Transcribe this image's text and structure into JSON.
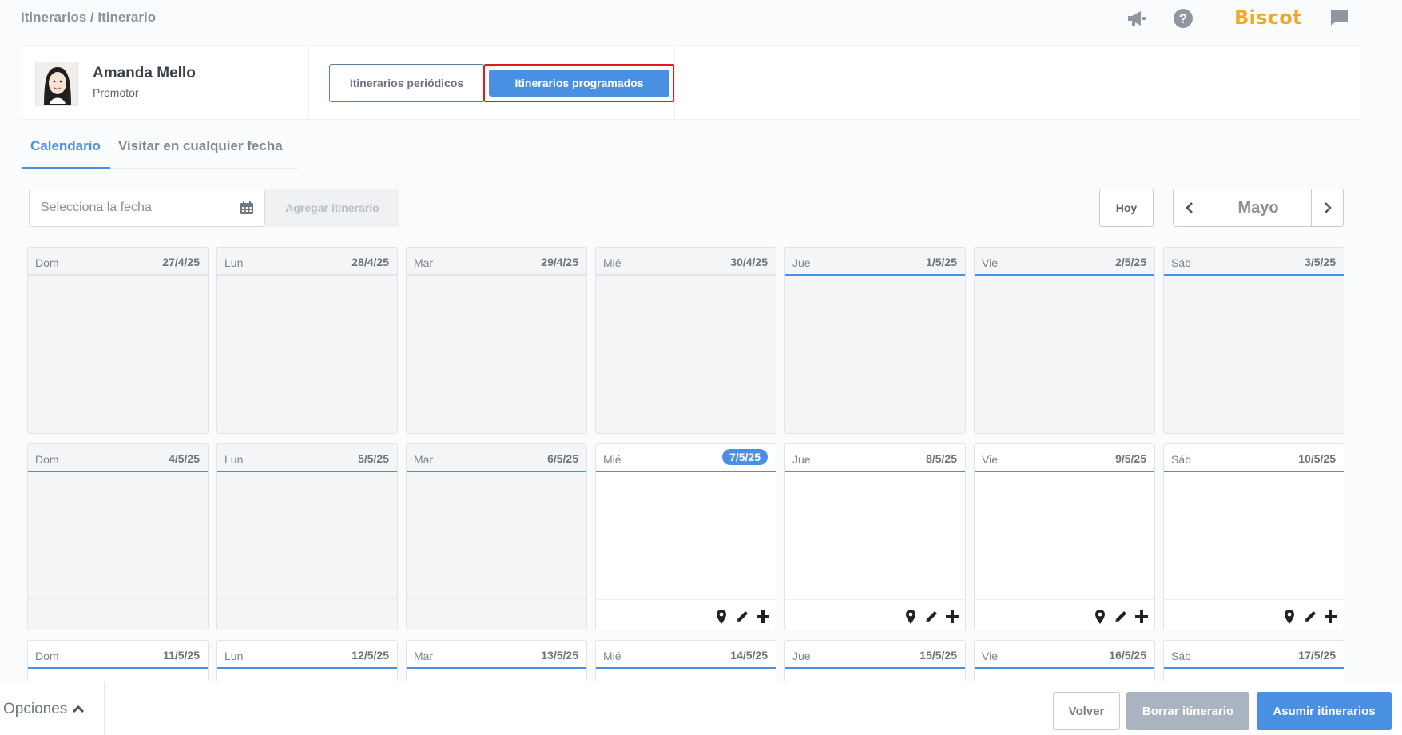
{
  "breadcrumb": "Itinerarios / Itinerario",
  "brand": "Biscoit",
  "top_icons": [
    "megaphone-icon",
    "help-icon",
    "chat-icon"
  ],
  "profile": {
    "name": "Amanda Mello",
    "role": "Promotor"
  },
  "segments": {
    "periodic": "Itinerarios periódicos",
    "scheduled": "Itinerarios programados"
  },
  "tabs": {
    "calendar": "Calendario",
    "any_date": "Visitar en cualquier fecha"
  },
  "date_field": {
    "placeholder": "Selecciona la fecha"
  },
  "add_button": "Agregar itinerario",
  "today_button": "Hoy",
  "month": "Mayo",
  "weeks": [
    [
      {
        "day": "Dom",
        "date": "27/4/25"
      },
      {
        "day": "Lun",
        "date": "28/4/25"
      },
      {
        "day": "Mar",
        "date": "29/4/25"
      },
      {
        "day": "Mié",
        "date": "30/4/25"
      },
      {
        "day": "Jue",
        "date": "1/5/25"
      },
      {
        "day": "Vie",
        "date": "2/5/25"
      },
      {
        "day": "Sáb",
        "date": "3/5/25"
      }
    ],
    [
      {
        "day": "Dom",
        "date": "4/5/25"
      },
      {
        "day": "Lun",
        "date": "5/5/25"
      },
      {
        "day": "Mar",
        "date": "6/5/25"
      },
      {
        "day": "Mié",
        "date": "7/5/25"
      },
      {
        "day": "Jue",
        "date": "8/5/25"
      },
      {
        "day": "Vie",
        "date": "9/5/25"
      },
      {
        "day": "Sáb",
        "date": "10/5/25"
      }
    ],
    [
      {
        "day": "Dom",
        "date": "11/5/25"
      },
      {
        "day": "Lun",
        "date": "12/5/25"
      },
      {
        "day": "Mar",
        "date": "13/5/25"
      },
      {
        "day": "Mié",
        "date": "14/5/25"
      },
      {
        "day": "Jue",
        "date": "15/5/25"
      },
      {
        "day": "Vie",
        "date": "16/5/25"
      },
      {
        "day": "Sáb",
        "date": "17/5/25"
      }
    ]
  ],
  "bottom": {
    "options": "Opciones",
    "back": "Volver",
    "delete": "Borrar itinerario",
    "assume": "Asumir itinerarios"
  },
  "colors": {
    "accent": "#4a90e2",
    "brand": "#f5a623",
    "highlight": "#e01b1b"
  }
}
